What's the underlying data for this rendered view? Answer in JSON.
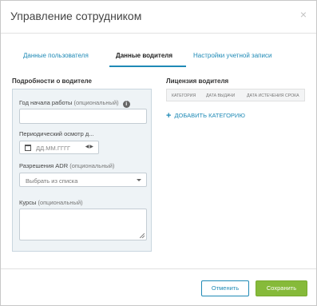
{
  "modal": {
    "title": "Управление сотрудником",
    "close_glyph": "×"
  },
  "tabs": [
    {
      "label": "Данные пользователя",
      "active": false
    },
    {
      "label": "Данные водителя",
      "active": true
    },
    {
      "label": "Настройки учетной записи",
      "active": false
    }
  ],
  "driver_details": {
    "section_title": "Подробности о водителе",
    "start_year": {
      "label": "Год начала работы",
      "optional": "(опциональный)",
      "value": ""
    },
    "checkup": {
      "label": "Периодический осмотр д...",
      "placeholder": "ДД.ММ.ГГГГ"
    },
    "adr": {
      "label": "Разрешения ADR",
      "optional": "(опциональный)",
      "selected": "Выбрать из списка"
    },
    "courses": {
      "label": "Курсы",
      "optional": "(опциональный)",
      "value": ""
    }
  },
  "license": {
    "section_title": "Лицензия водителя",
    "columns": [
      "Категория",
      "Дата выдачи",
      "Дата истечения срока"
    ],
    "add_category_label": "ДОБАВИТЬ КАТЕГОРИЮ"
  },
  "footer": {
    "cancel_label": "Отменить",
    "save_label": "Сохранить"
  },
  "colors": {
    "accent": "#1f8ab6",
    "save": "#86ba3a",
    "panel_bg": "#eef3f6"
  }
}
